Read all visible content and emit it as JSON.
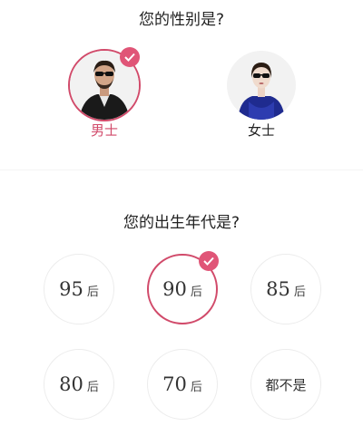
{
  "gender_section": {
    "question": "您的性别是?",
    "options": [
      {
        "label": "男士",
        "selected": true
      },
      {
        "label": "女士",
        "selected": false
      }
    ]
  },
  "decade_section": {
    "question": "您的出生年代是?",
    "options": [
      {
        "num": "95",
        "suffix": "后",
        "selected": false
      },
      {
        "num": "90",
        "suffix": "后",
        "selected": true
      },
      {
        "num": "85",
        "suffix": "后",
        "selected": false
      },
      {
        "num": "80",
        "suffix": "后",
        "selected": false
      },
      {
        "num": "70",
        "suffix": "后",
        "selected": false
      },
      {
        "label": "都不是",
        "selected": false
      }
    ]
  },
  "colors": {
    "accent": "#e05577",
    "accent_text": "#d14a6a",
    "ring": "#ececec"
  }
}
